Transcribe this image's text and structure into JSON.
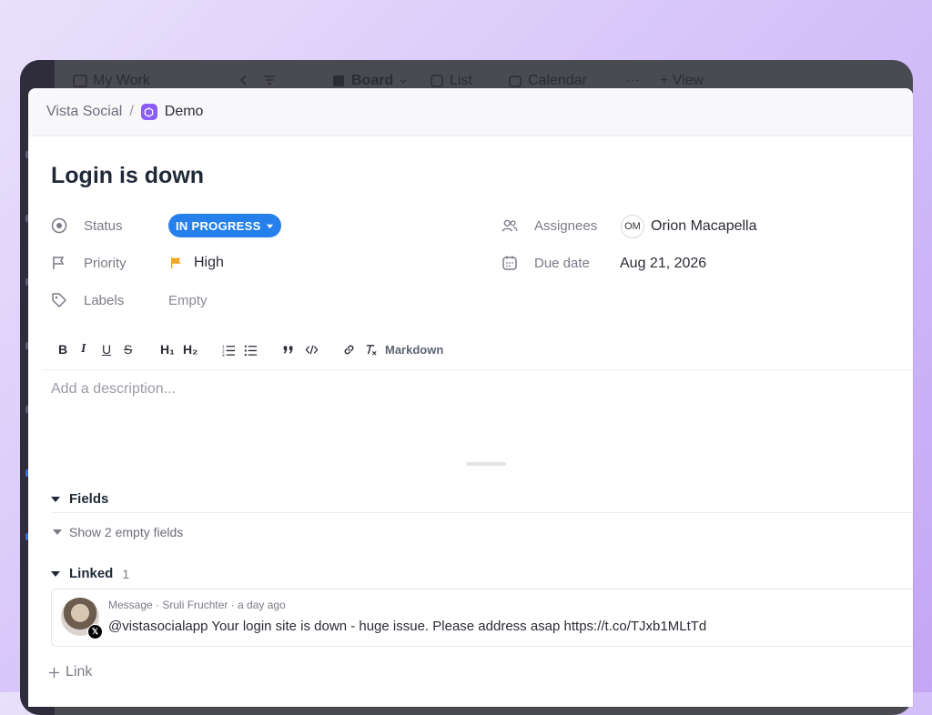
{
  "app": {
    "view_name": "My Work",
    "tabs": [
      {
        "label": "Board",
        "active": true
      },
      {
        "label": "List"
      },
      {
        "label": "Calendar"
      }
    ],
    "more_label": "···",
    "add_view_label": "+ View"
  },
  "breadcrumb": {
    "parent": "Vista Social",
    "separator": "/",
    "current": "Demo",
    "space_color": "#8b5cf6"
  },
  "task": {
    "title": "Login is down",
    "status": {
      "label": "Status",
      "value": "IN PROGRESS",
      "color": "#2680eb"
    },
    "priority": {
      "label": "Priority",
      "value": "High",
      "flag_color": "#f5a524"
    },
    "labels": {
      "label": "Labels",
      "value": "Empty"
    },
    "assignees": {
      "label": "Assignees",
      "initials": "OM",
      "name": "Orion Macapella"
    },
    "due_date": {
      "label": "Due date",
      "value": "Aug 21, 2026"
    }
  },
  "editor": {
    "toolbar": {
      "bold": "B",
      "italic": "I",
      "underline": "U",
      "strike": "S",
      "h1": "H₁",
      "h2": "H₂",
      "markdown_label": "Markdown"
    },
    "placeholder": "Add a description..."
  },
  "fields_section": {
    "title": "Fields",
    "show_empty_label": "Show 2 empty fields"
  },
  "linked_section": {
    "title": "Linked",
    "count": "1",
    "items": [
      {
        "meta": "Message · Sruli Fruchter · a day ago",
        "text": "@vistasocialapp Your login site is down - huge issue. Please address asap https://t.co/TJxb1MLtTd",
        "source_icon": "x-logo"
      }
    ],
    "add_link_label": "Link"
  }
}
